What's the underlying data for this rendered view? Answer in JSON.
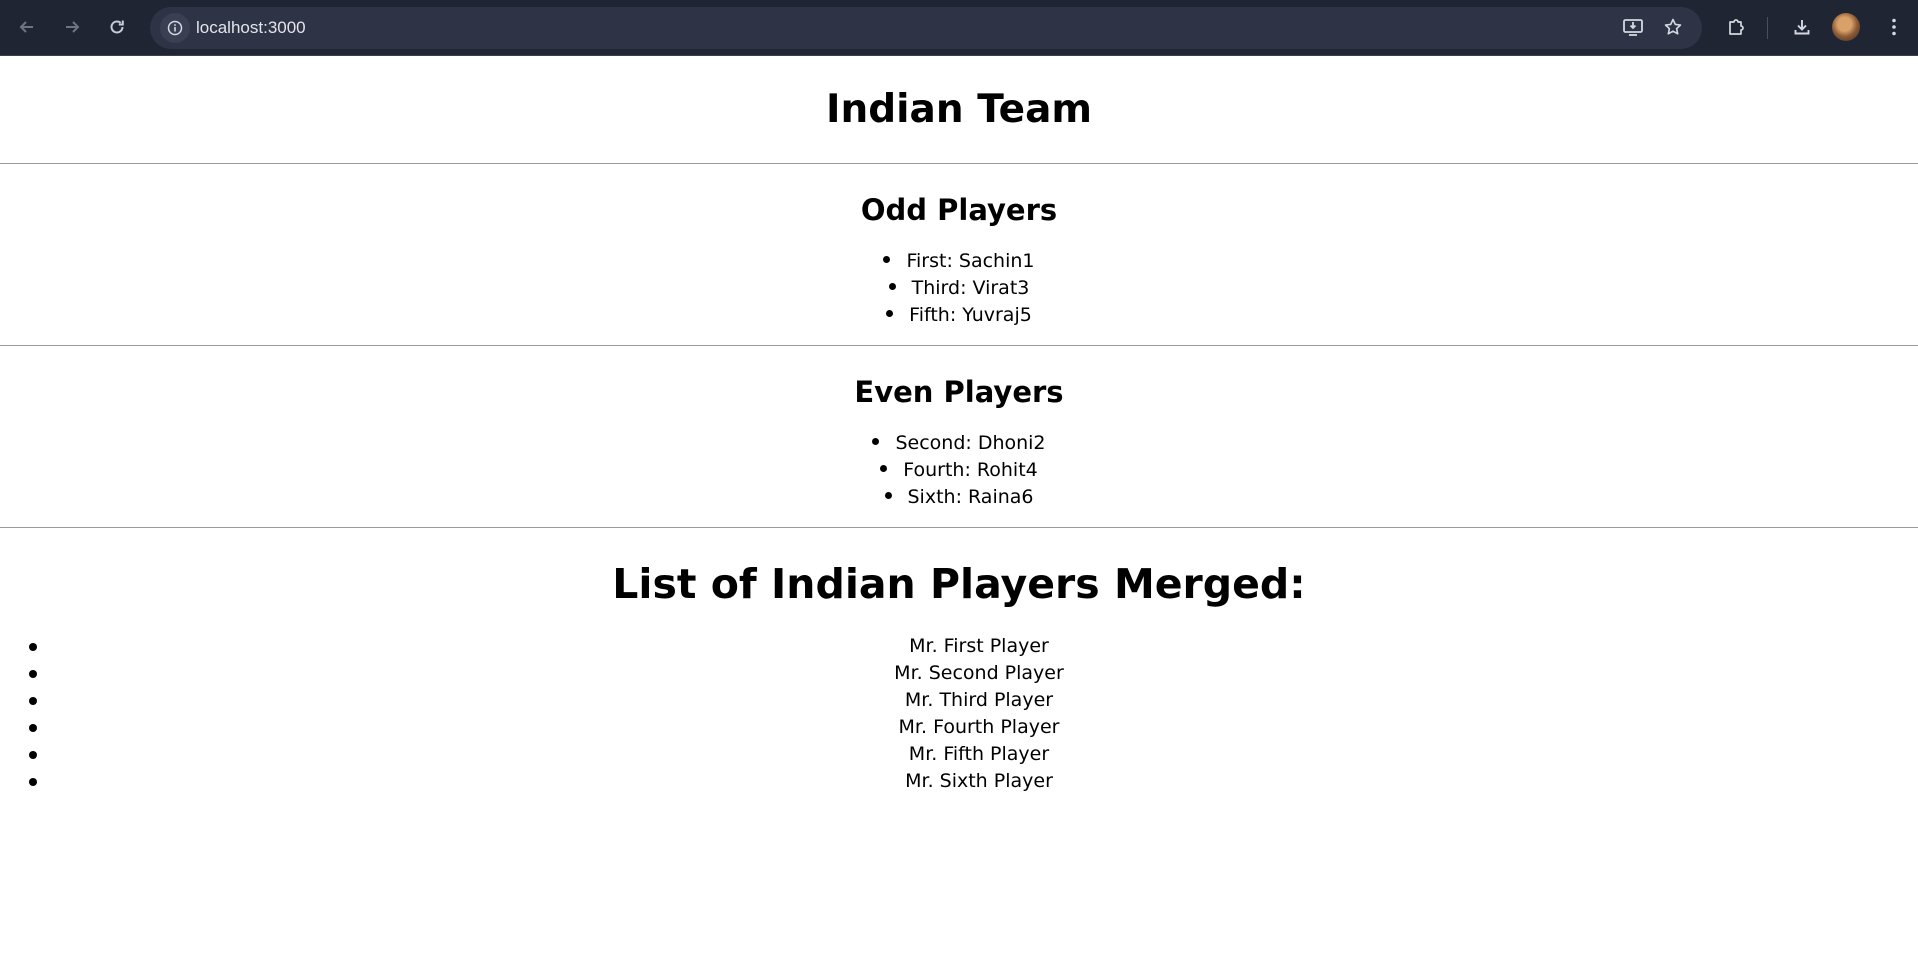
{
  "browser": {
    "url": "localhost:3000",
    "icons": {
      "back": "arrow-left-icon",
      "forward": "arrow-right-icon",
      "reload": "reload-icon",
      "site_info": "info-icon",
      "install": "install-app-icon",
      "bookmark": "star-icon",
      "extensions": "puzzle-icon",
      "downloads": "download-icon",
      "menu": "kebab-menu-icon"
    }
  },
  "page": {
    "title": "Indian Team",
    "odd": {
      "heading": "Odd Players",
      "items": [
        "First: Sachin1",
        "Third: Virat3",
        "Fifth: Yuvraj5"
      ]
    },
    "even": {
      "heading": "Even Players",
      "items": [
        "Second: Dhoni2",
        "Fourth: Rohit4",
        "Sixth: Raina6"
      ]
    },
    "merged": {
      "heading": "List of Indian Players Merged:",
      "items": [
        "Mr. First Player",
        "Mr. Second Player",
        "Mr. Third Player",
        "Mr. Fourth Player",
        "Mr. Fifth Player",
        "Mr. Sixth Player"
      ]
    }
  }
}
